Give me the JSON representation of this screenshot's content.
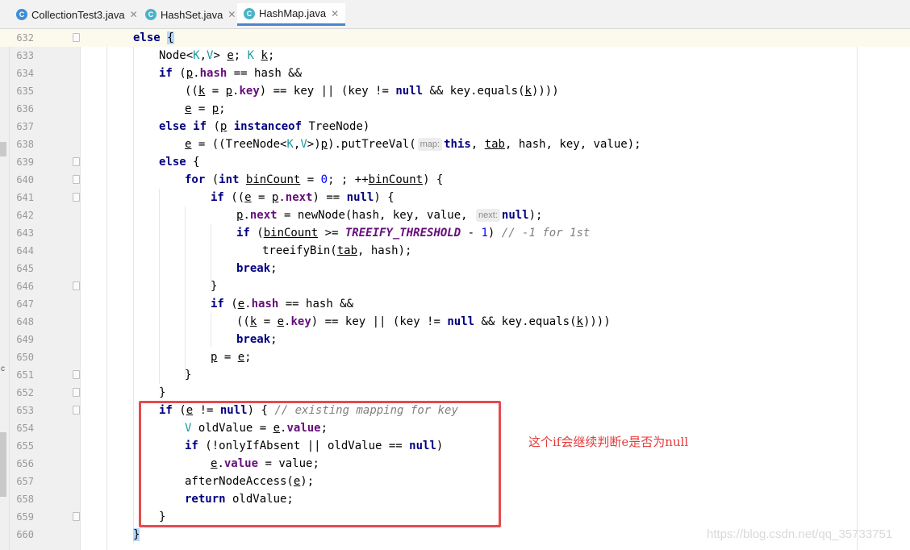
{
  "tabs": [
    {
      "label": "CollectionTest3.java",
      "icon": "java-class-icon",
      "icon_color": "#3d8fd6",
      "active": false
    },
    {
      "label": "HashSet.java",
      "icon": "java-class-icon",
      "icon_color": "#4ab3c8",
      "active": false
    },
    {
      "label": "HashMap.java",
      "icon": "java-class-icon",
      "icon_color": "#4ab3c8",
      "active": true
    }
  ],
  "editor": {
    "current_line": "632",
    "lines": [
      {
        "n": "632"
      },
      {
        "n": "633"
      },
      {
        "n": "634"
      },
      {
        "n": "635"
      },
      {
        "n": "636"
      },
      {
        "n": "637"
      },
      {
        "n": "638"
      },
      {
        "n": "639"
      },
      {
        "n": "640"
      },
      {
        "n": "641"
      },
      {
        "n": "642"
      },
      {
        "n": "643"
      },
      {
        "n": "644"
      },
      {
        "n": "645"
      },
      {
        "n": "646"
      },
      {
        "n": "647"
      },
      {
        "n": "648"
      },
      {
        "n": "649"
      },
      {
        "n": "650"
      },
      {
        "n": "651"
      },
      {
        "n": "652"
      },
      {
        "n": "653"
      },
      {
        "n": "654"
      },
      {
        "n": "655"
      },
      {
        "n": "656"
      },
      {
        "n": "657"
      },
      {
        "n": "658"
      },
      {
        "n": "659"
      },
      {
        "n": "660"
      }
    ],
    "hints": {
      "map": "map:",
      "next": "next:"
    },
    "comments": {
      "treeify": "// -1 for 1st",
      "existing": "// existing mapping for key"
    },
    "constants": {
      "treeify_threshold": "TREEIFY_THRESHOLD"
    }
  },
  "annotation": {
    "text": "这个if会继续判断e是否为null",
    "color": "#e63b3b"
  },
  "highlight_box_color": "#e44b4f",
  "watermark": "https://blog.csdn.net/qq_35733751"
}
